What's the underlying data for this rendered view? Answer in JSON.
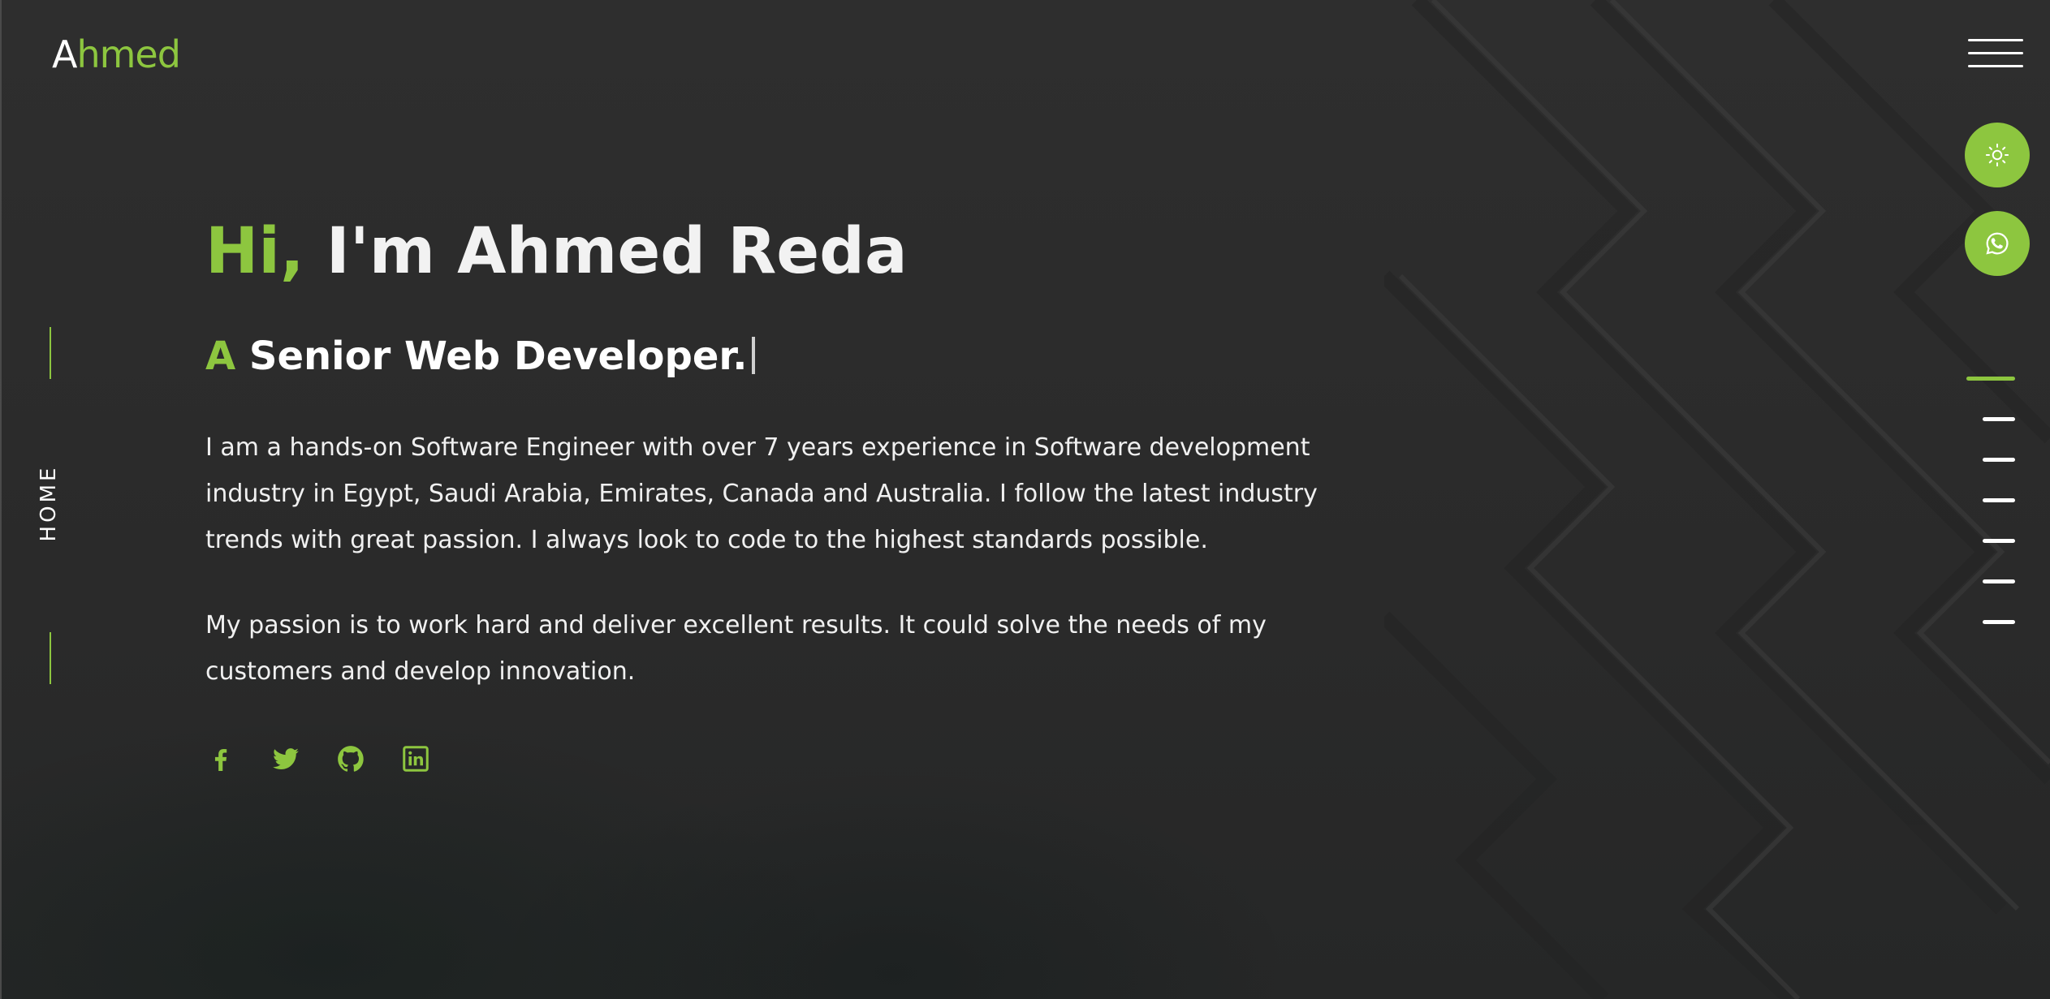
{
  "brand": {
    "logo_first": "A",
    "logo_rest": "hmed",
    "accent_color": "#8dc63f"
  },
  "side": {
    "section_label": "HOME"
  },
  "hero": {
    "greeting": "Hi,",
    "name_text": " I'm Ahmed Reda",
    "role_prefix": "A",
    "role_text": " Senior Web Developer.",
    "paragraph_1": "I am a hands-on Software Engineer with over 7 years experience in Software development industry in Egypt, Saudi Arabia, Emirates, Canada and Australia. I follow the latest industry trends with great passion. I always look to code to the highest standards possible.",
    "paragraph_2": "My passion is to work hard and deliver excellent results. It could solve the needs of my customers and develop innovation."
  },
  "socials": [
    {
      "name": "facebook-icon"
    },
    {
      "name": "twitter-icon"
    },
    {
      "name": "github-icon"
    },
    {
      "name": "linkedin-icon"
    }
  ],
  "right_controls": {
    "menu_icon": "hamburger-icon",
    "theme_icon": "sun-icon",
    "chat_icon": "whatsapp-icon"
  },
  "section_nav": {
    "count": 7,
    "active_index": 0
  }
}
